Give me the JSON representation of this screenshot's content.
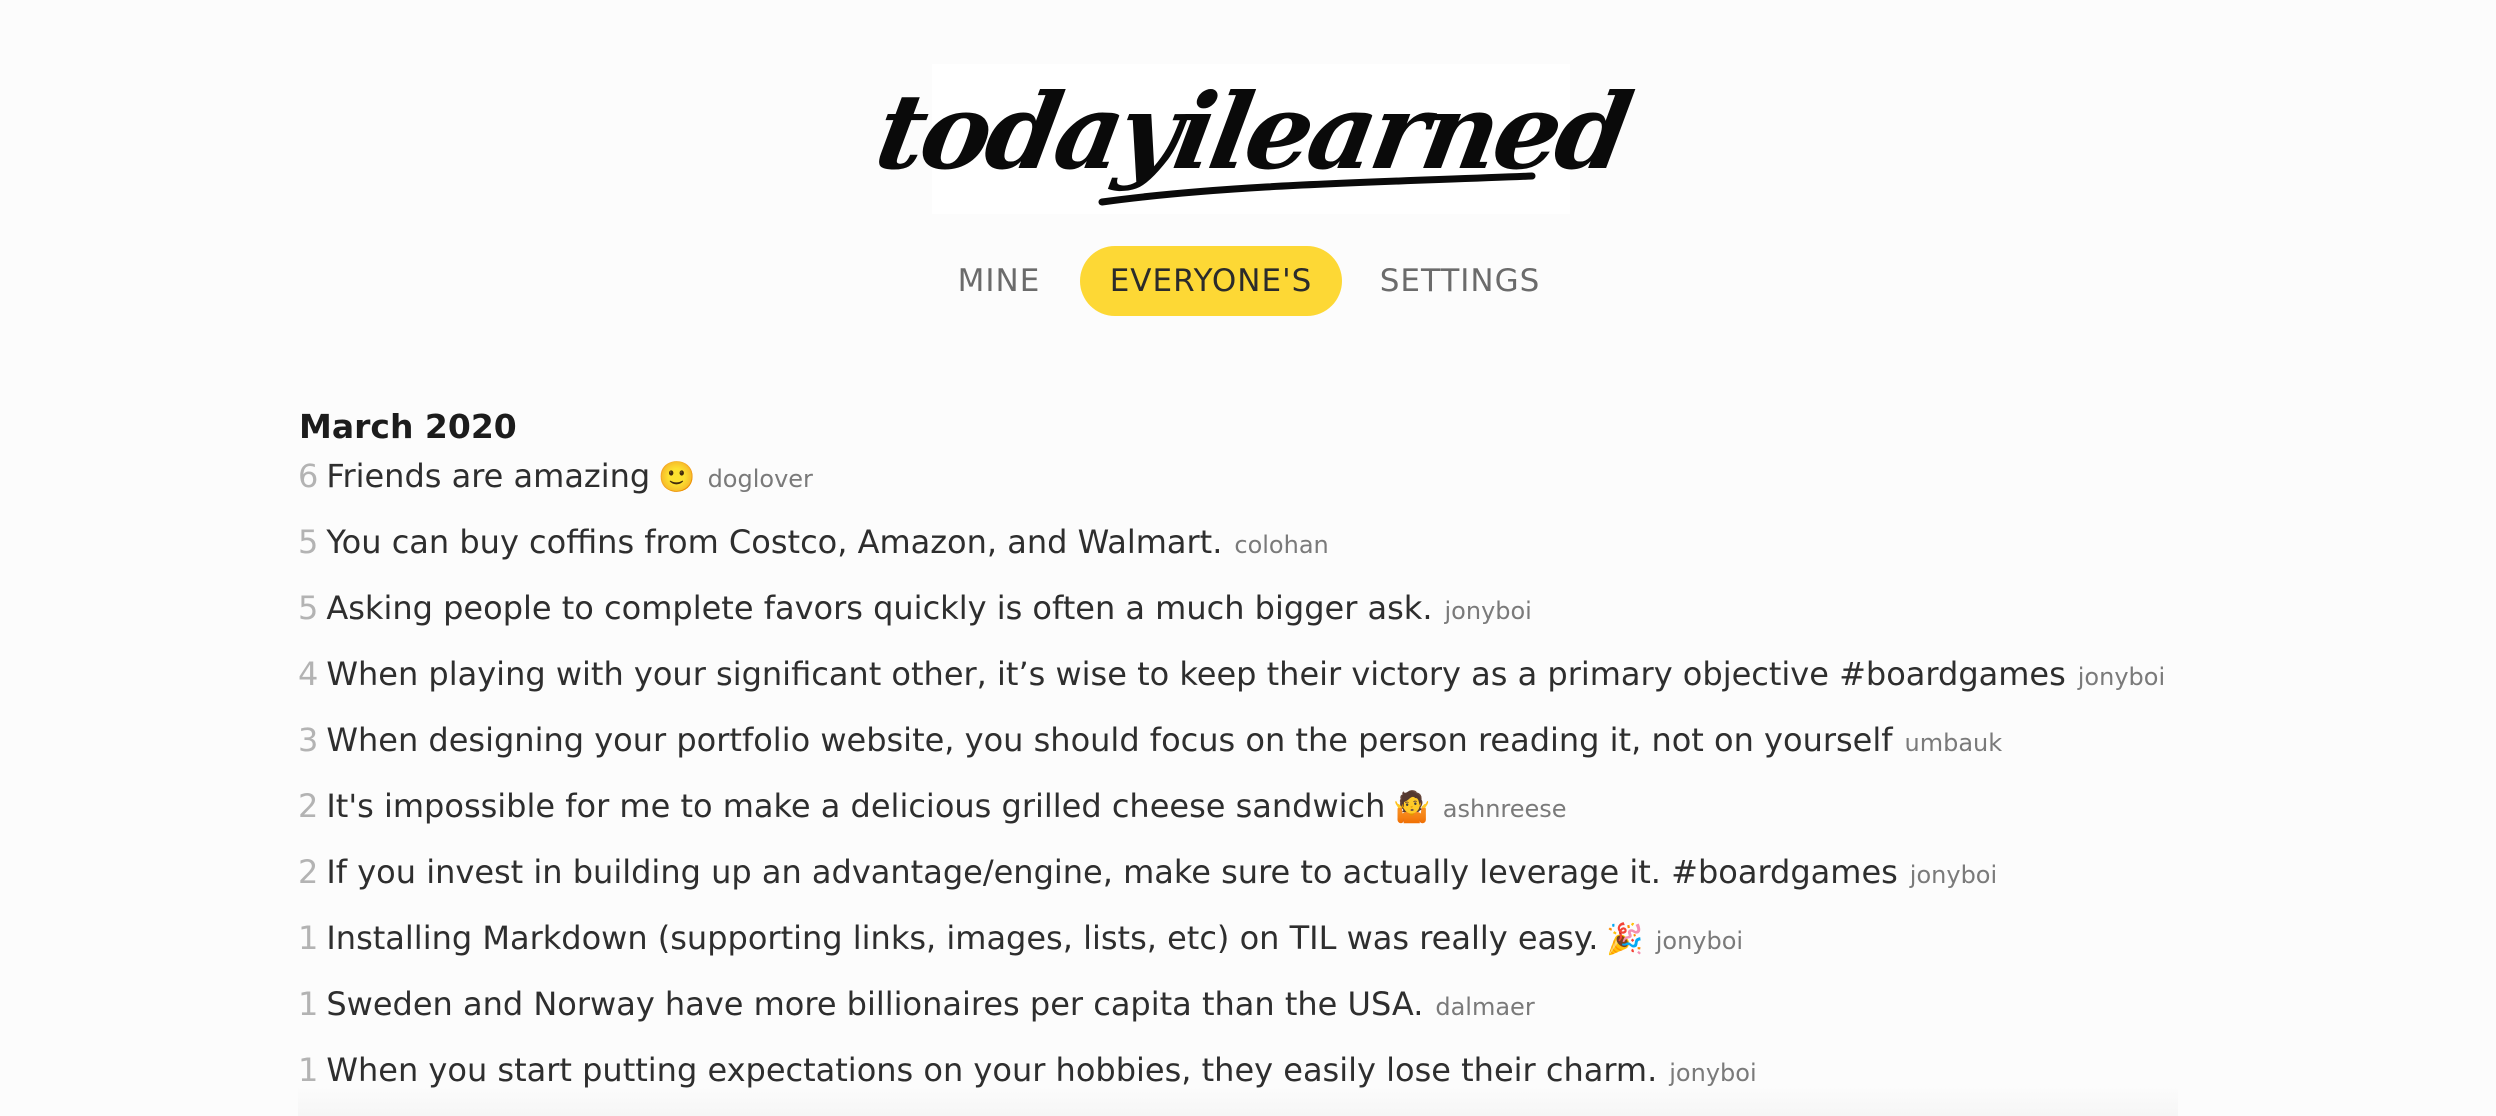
{
  "brand": {
    "logo_text": "todayilearned"
  },
  "nav": {
    "items": [
      {
        "label": "MINE"
      },
      {
        "label": "EVERYONE'S"
      },
      {
        "label": "SETTINGS"
      }
    ],
    "active_color": "#fdd835"
  },
  "month": {
    "heading": "March 2020"
  },
  "entries": [
    {
      "count": "6",
      "text": "Friends are amazing",
      "emoji": "🙂",
      "author": "doglover"
    },
    {
      "count": "5",
      "text": "You can buy coffins from Costco, Amazon, and Walmart.",
      "emoji": "",
      "author": "colohan"
    },
    {
      "count": "5",
      "text": "Asking people to complete favors quickly is often a much bigger ask.",
      "emoji": "",
      "author": "jonyboi"
    },
    {
      "count": "4",
      "text": "When playing with your significant other, it’s wise to keep their victory as a primary objective #boardgames",
      "emoji": "",
      "author": "jonyboi"
    },
    {
      "count": "3",
      "text": "When designing your portfolio website, you should focus on the person reading it, not on yourself",
      "emoji": "",
      "author": "umbauk"
    },
    {
      "count": "2",
      "text": "It's impossible for me to make a delicious grilled cheese sandwich",
      "emoji": "🤷",
      "author": "ashnreese"
    },
    {
      "count": "2",
      "text": "If you invest in building up an advantage/engine, make sure to actually leverage it. #boardgames",
      "emoji": "",
      "author": "jonyboi"
    },
    {
      "count": "1",
      "text": "Installing Markdown (supporting links, images, lists, etc) on TIL was really easy.",
      "emoji": "🎉",
      "author": "jonyboi"
    },
    {
      "count": "1",
      "text": "Sweden and Norway have more billionaires per capita than the USA.",
      "emoji": "",
      "author": "dalmaer"
    },
    {
      "count": "1",
      "text": "When you start putting expectations on your hobbies, they easily lose their charm.",
      "emoji": "",
      "author": "jonyboi"
    }
  ]
}
